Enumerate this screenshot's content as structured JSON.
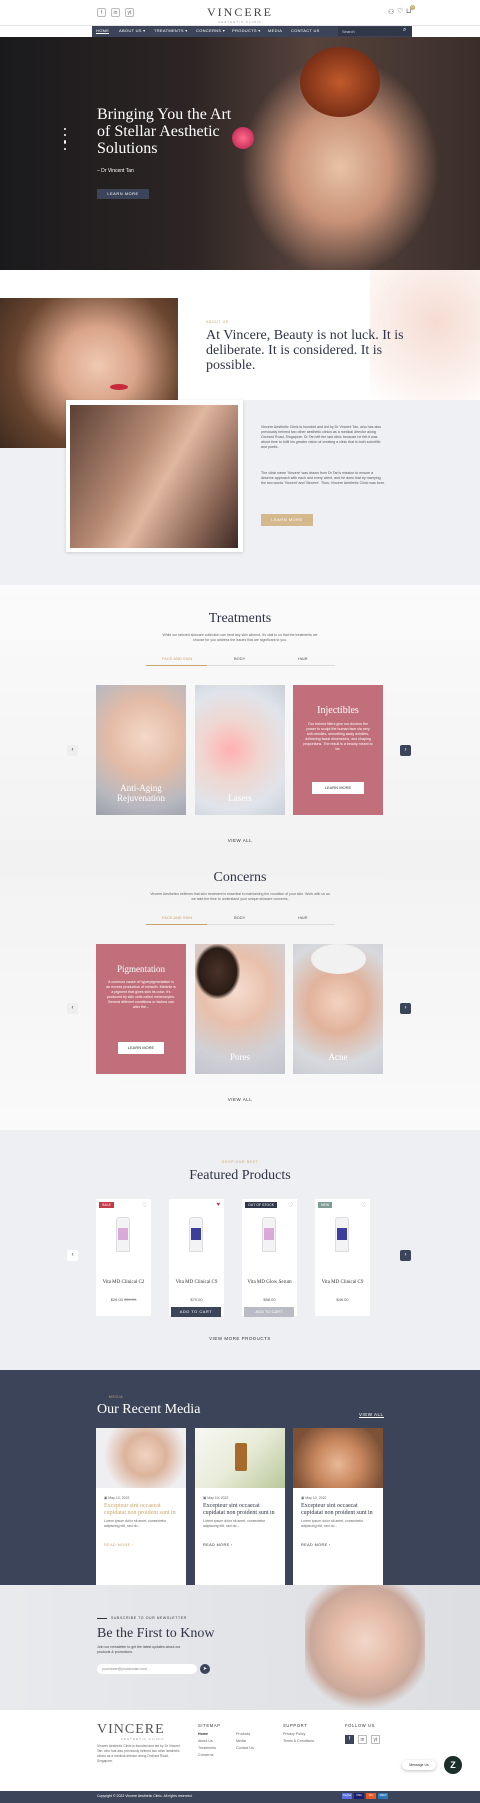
{
  "header": {
    "social": [
      "f",
      "in",
      "yt"
    ],
    "brand": "VINCERE",
    "brand_sub": "AESTHETIC CLINIC",
    "icons": [
      "user-icon",
      "heart-icon",
      "cart-icon"
    ],
    "cart_count": "0"
  },
  "nav": {
    "items": [
      "HOME",
      "ABOUT US ▾",
      "TREATMENTS ▾",
      "CONCERNS ▾",
      "PRODUCTS ▾",
      "MEDIA",
      "CONTACT US"
    ],
    "search_placeholder": "Search"
  },
  "hero": {
    "title": "Bringing You the Art of Stellar Aesthetic Solutions",
    "byline": "– Dr Vincent Tan",
    "button": "LEARN MORE"
  },
  "about": {
    "tag": "ABOUT US",
    "quote": "At Vincere, Beauty is not luck. It is deliberate. It is considered. It is possible.",
    "para1": "Vincere Aesthetic Clinic is founded and led by Dr Vincent Tan, who has also previously helmed two other aesthetic clinics as a medical director along Orchard Road, Singapore. Dr Tan left the last clinic because he felt it was about time to fulfil his greater vision of creating a clinic that is both scientific and poetic.",
    "para2": "The clinic name 'Vincere' was drawn from Dr Tan's mission to ensure a deserve approach with each and every client, and he does that by marrying the two words 'Vincent' and 'Sincere'. Thus, Vincere Aesthetic Clinic was born.",
    "button": "LEARN MORE"
  },
  "treatments": {
    "title": "Treatments",
    "subtitle": "While our tailored skincare collection can treat any skin ailment, it's vital to us that the treatments we choose for you address the issues that are significant to you.",
    "tabs": [
      "FACE AND SKIN",
      "BODY",
      "HAIR"
    ],
    "cards": [
      {
        "label": "Anti-Aging Rejuvenation"
      },
      {
        "label": "Lasers"
      },
      {
        "label": "Injectibles",
        "text": "Our trained fillers give our doctors the power to sculpt the human face via very soft needles, smoothing away wrinkles, delivering facial dimensions, and shaping proportions. The result is a beauty meant to be.",
        "button": "LEARN MORE"
      }
    ],
    "view_all": "VIEW ALL"
  },
  "concerns": {
    "title": "Concerns",
    "subtitle": "Vincere Aesthetics believes that skin treatment is essential in maintaining the condition of your skin. Work with us as we take the time to understand your unique skincare concerns.",
    "tabs": [
      "FACE AND SKIN",
      "BODY",
      "HAIR"
    ],
    "cards": [
      {
        "label": "Pigmentation",
        "text": "A common cause of hyperpigmentation is an excess production of melanin. Melanin is a pigment that gives skin its color. It's produced by skin cells called melanocytes. Several different conditions or factors can alter the...",
        "button": "LEARN MORE"
      },
      {
        "label": "Pores"
      },
      {
        "label": "Acne"
      }
    ],
    "view_all": "VIEW ALL"
  },
  "products": {
    "tag": "SHOP OUR BEST",
    "title": "Featured Products",
    "items": [
      {
        "badge": "SALE",
        "name": "Vita MD Clinical C2",
        "price": "$26.00",
        "old": "$30.00",
        "color": "#d9a9d8"
      },
      {
        "badge": "",
        "name": "Vita MD Clinical C9",
        "price": "$70.00",
        "old": "",
        "color": "#3c3f99",
        "cart": "ADD TO CART"
      },
      {
        "badge": "OUT OF STOCK",
        "name": "Vita MD Glow Serum",
        "price": "$58.00",
        "old": "",
        "color": "#d9a9d8",
        "cart": "ADD TO CART"
      },
      {
        "badge": "NEW",
        "name": "Vita MD Clinical C9",
        "price": "$46.00",
        "old": "",
        "color": "#3c3f99"
      }
    ],
    "view_more": "VIEW MORE PRODUCTS"
  },
  "media": {
    "tag": "MEDIA",
    "title": "Our Recent Media",
    "view_all": "VIEW ALL",
    "posts": [
      {
        "date": "May 10, 2022",
        "title": "Excepteur sint occaecat cupidatat non proident sunt in",
        "text": "Lorem ipsum dolor sit amet, consectetur adipiscing elit, sed do...",
        "more": "READ MORE ›"
      },
      {
        "date": "May 10, 2022",
        "title": "Excepteur sint occaecat cupidatat non proident sunt in",
        "text": "Lorem ipsum dolor sit amet, consectetur adipiscing elit, sed do...",
        "more": "READ MORE ›"
      },
      {
        "date": "May 10, 2022",
        "title": "Excepteur sint occaecat cupidatat non proident sunt in",
        "text": "Lorem ipsum dolor sit amet, consectetur adipiscing elit, sed do...",
        "more": "READ MORE ›"
      }
    ]
  },
  "newsletter": {
    "tag": "SUBSCRIBE TO OUR NEWSLETTER",
    "title": "Be the First to Know",
    "text": "Join our newsletter to get the latest updates about our products & promotions.",
    "placeholder": "yourname@yourdomain.com"
  },
  "footer": {
    "brand": "VINCERE",
    "brand_sub": "AESTHETIC CLINIC",
    "about": "Vincere Aesthetic Clinic is founded and led by Dr Vincent Tan, who has also previously helmed two other aesthetic clinics as a medical director along Orchard Road, Singapore.",
    "sitemap_title": "SITEMAP",
    "sitemap_a": [
      "Home",
      "About Us",
      "Treatments",
      "Concerns"
    ],
    "sitemap_b": [
      "Products",
      "Media",
      "Contact Us"
    ],
    "support_title": "SUPPORT",
    "support": [
      "Privacy Policy",
      "Terms & Conditions"
    ],
    "follow_title": "FOLLOW US",
    "copyright": "Copyright © 2022 Vincere Aesthetic Clinic. All rights reserved.",
    "chat": "Message Us",
    "payments": [
      "PayPal",
      "VISA",
      "MC",
      "AMEX"
    ]
  }
}
